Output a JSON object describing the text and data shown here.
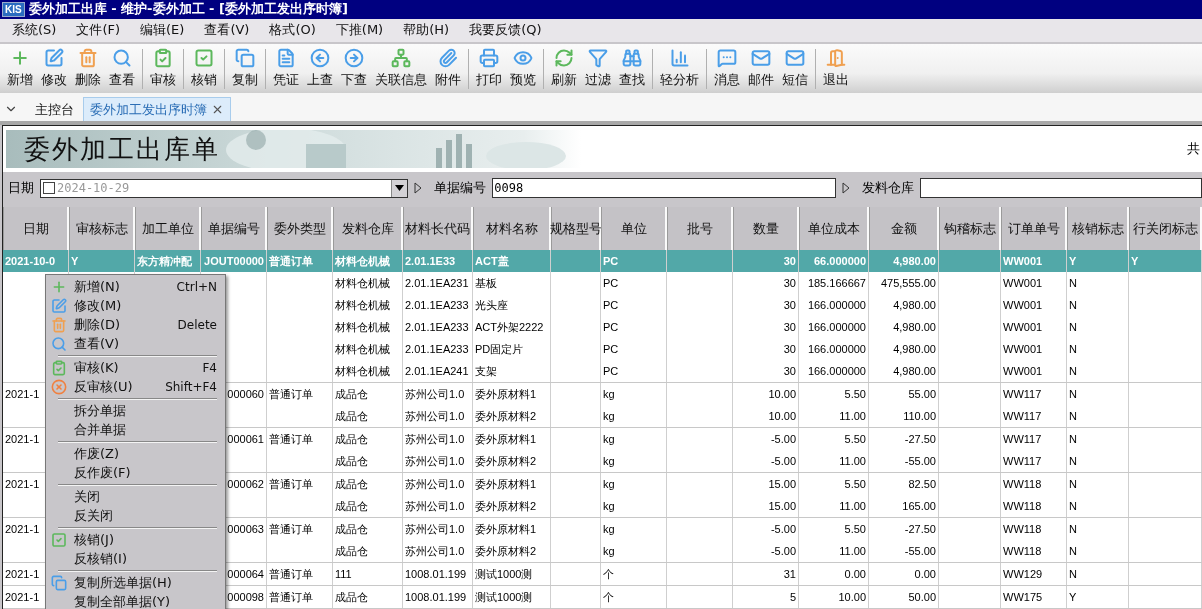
{
  "window": {
    "logo": "KIS",
    "title": "委外加工出库 - 维护-委外加工 - [委外加工发出序时簿]"
  },
  "menu_bar": [
    "系统(S)",
    "文件(F)",
    "编辑(E)",
    "查看(V)",
    "格式(O)",
    "下推(M)",
    "帮助(H)",
    "我要反馈(Q)"
  ],
  "toolbar": [
    [
      "新增",
      "修改",
      "删除",
      "查看"
    ],
    [
      "审核"
    ],
    [
      "核销"
    ],
    [
      "复制"
    ],
    [
      "凭证",
      "上查",
      "下查",
      "关联信息",
      "附件"
    ],
    [
      "打印",
      "预览"
    ],
    [
      "刷新",
      "过滤",
      "查找"
    ],
    [
      "轻分析"
    ],
    [
      "消息",
      "邮件",
      "短信"
    ],
    [
      "退出"
    ]
  ],
  "tabs": [
    {
      "label": "主控台",
      "selected": false,
      "closable": false
    },
    {
      "label": "委外加工发出序时簿",
      "selected": true,
      "closable": true
    }
  ],
  "report": {
    "title": "委外加工出库单",
    "side_text": "共"
  },
  "filters": {
    "date": {
      "label": "日期",
      "checked": false,
      "value": "2024-10-29"
    },
    "bill_no": {
      "label": "单据编号",
      "value": "0098"
    },
    "warehouse": {
      "label": "发料仓库"
    }
  },
  "table": {
    "columns": [
      "日期",
      "审核标志",
      "加工单位",
      "单据编号",
      "委外类型",
      "发料仓库",
      "材料长代码",
      "材料名称",
      "规格型号",
      "单位",
      "批号",
      "数量",
      "单位成本",
      "金额",
      "钩稽标志",
      "订单单号",
      "核销标志",
      "行关闭标志"
    ],
    "groups": [
      {
        "rows": [
          {
            "selected": true,
            "cells": [
              "2021-10-0",
              "Y",
              "东方精冲配",
              "JOUT00000",
              "普通订单",
              "材料仓机械",
              "2.01.1E33",
              "ACT盖",
              null,
              "PC",
              null,
              "30",
              "66.000000",
              "4,980.00",
              null,
              "WW001",
              "Y",
              "Y"
            ]
          },
          {
            "selected": false,
            "cells": [
              null,
              null,
              null,
              null,
              null,
              "材料仓机械",
              "2.01.1EA231",
              "基板",
              null,
              "PC",
              null,
              "30",
              "185.166667",
              "475,555.00",
              null,
              "WW001",
              "N",
              null
            ]
          },
          {
            "selected": false,
            "cells": [
              null,
              null,
              null,
              null,
              null,
              "材料仓机械",
              "2.01.1EA233",
              "光头座",
              null,
              "PC",
              null,
              "30",
              "166.000000",
              "4,980.00",
              null,
              "WW001",
              "N",
              null
            ]
          },
          {
            "selected": false,
            "cells": [
              null,
              null,
              null,
              null,
              null,
              "材料仓机械",
              "2.01.1EA233",
              "ACT外架2222",
              null,
              "PC",
              null,
              "30",
              "166.000000",
              "4,980.00",
              null,
              "WW001",
              "N",
              null
            ]
          },
          {
            "selected": false,
            "cells": [
              null,
              null,
              null,
              null,
              null,
              "材料仓机械",
              "2.01.1EA233",
              "PD固定片",
              null,
              "PC",
              null,
              "30",
              "166.000000",
              "4,980.00",
              null,
              "WW001",
              "N",
              null
            ]
          },
          {
            "selected": false,
            "cells": [
              null,
              null,
              null,
              null,
              null,
              "材料仓机械",
              "2.01.1EA241",
              "支架",
              null,
              "PC",
              null,
              "30",
              "166.000000",
              "4,980.00",
              null,
              "WW001",
              "N",
              null
            ]
          }
        ]
      },
      {
        "rows": [
          {
            "selected": false,
            "cells": [
              "2021-1",
              null,
              null,
              "000060",
              "普通订单",
              "成品仓",
              "苏州公司1.0",
              "委外原材料1",
              null,
              "kg",
              null,
              "10.00",
              "5.50",
              "55.00",
              null,
              "WW117",
              "N",
              null
            ]
          },
          {
            "selected": false,
            "cells": [
              null,
              null,
              null,
              null,
              null,
              "成品仓",
              "苏州公司1.0",
              "委外原材料2",
              null,
              "kg",
              null,
              "10.00",
              "11.00",
              "110.00",
              null,
              "WW117",
              "N",
              null
            ]
          }
        ]
      },
      {
        "rows": [
          {
            "selected": false,
            "cells": [
              "2021-1",
              null,
              null,
              "000061",
              "普通订单",
              "成品仓",
              "苏州公司1.0",
              "委外原材料1",
              null,
              "kg",
              null,
              "-5.00",
              "5.50",
              "-27.50",
              null,
              "WW117",
              "N",
              null
            ]
          },
          {
            "selected": false,
            "cells": [
              null,
              null,
              null,
              null,
              null,
              "成品仓",
              "苏州公司1.0",
              "委外原材料2",
              null,
              "kg",
              null,
              "-5.00",
              "11.00",
              "-55.00",
              null,
              "WW117",
              "N",
              null
            ]
          }
        ]
      },
      {
        "rows": [
          {
            "selected": false,
            "cells": [
              "2021-1",
              null,
              null,
              "000062",
              "普通订单",
              "成品仓",
              "苏州公司1.0",
              "委外原材料1",
              null,
              "kg",
              null,
              "15.00",
              "5.50",
              "82.50",
              null,
              "WW118",
              "N",
              null
            ]
          },
          {
            "selected": false,
            "cells": [
              null,
              null,
              null,
              null,
              null,
              "成品仓",
              "苏州公司1.0",
              "委外原材料2",
              null,
              "kg",
              null,
              "15.00",
              "11.00",
              "165.00",
              null,
              "WW118",
              "N",
              null
            ]
          }
        ]
      },
      {
        "rows": [
          {
            "selected": false,
            "cells": [
              "2021-1",
              null,
              null,
              "000063",
              "普通订单",
              "成品仓",
              "苏州公司1.0",
              "委外原材料1",
              null,
              "kg",
              null,
              "-5.00",
              "5.50",
              "-27.50",
              null,
              "WW118",
              "N",
              null
            ]
          },
          {
            "selected": false,
            "cells": [
              null,
              null,
              null,
              null,
              null,
              "成品仓",
              "苏州公司1.0",
              "委外原材料2",
              null,
              "kg",
              null,
              "-5.00",
              "11.00",
              "-55.00",
              null,
              "WW118",
              "N",
              null
            ]
          }
        ]
      },
      {
        "rows": [
          {
            "selected": false,
            "cells": [
              "2021-1",
              null,
              null,
              "000064",
              "普通订单",
              "111",
              "1008.01.199",
              "测试1000测",
              null,
              "个",
              null,
              "31",
              "0.00",
              "0.00",
              null,
              "WW129",
              "N",
              null
            ]
          }
        ]
      },
      {
        "rows": [
          {
            "selected": false,
            "cells": [
              "2021-1",
              null,
              null,
              "000098",
              "普通订单",
              "成品仓",
              "1008.01.199",
              "测试1000测",
              null,
              "个",
              null,
              "5",
              "10.00",
              "50.00",
              null,
              "WW175",
              "Y",
              null
            ]
          }
        ]
      }
    ]
  },
  "context_menu": {
    "sections": [
      [
        {
          "label": "新增(N)",
          "shortcut": "Ctrl+N"
        },
        {
          "label": "修改(M)"
        },
        {
          "label": "删除(D)",
          "shortcut": "Delete"
        },
        {
          "label": "查看(V)"
        }
      ],
      [
        {
          "label": "审核(K)",
          "shortcut": "F4"
        },
        {
          "label": "反审核(U)",
          "shortcut": "Shift+F4"
        }
      ],
      [
        {
          "label": "拆分单据"
        },
        {
          "label": "合并单据"
        }
      ],
      [
        {
          "label": "作废(Z)"
        },
        {
          "label": "反作废(F)"
        }
      ],
      [
        {
          "label": "关闭"
        },
        {
          "label": "反关闭"
        }
      ],
      [
        {
          "label": "核销(J)"
        },
        {
          "label": "反核销(I)"
        }
      ],
      [
        {
          "label": "复制所选单据(H)"
        },
        {
          "label": "复制全部单据(Y)"
        }
      ]
    ]
  }
}
